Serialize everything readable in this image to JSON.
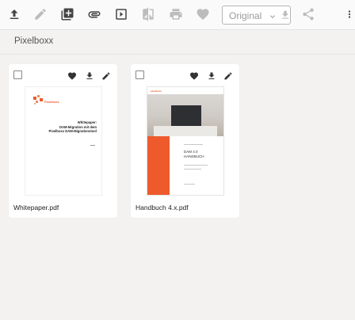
{
  "toolbar": {
    "icons": [
      {
        "name": "upload-icon",
        "state": "enabled"
      },
      {
        "name": "edit-icon",
        "state": "disabled"
      },
      {
        "name": "add-to-collection-icon",
        "state": "enabled"
      },
      {
        "name": "attachment-icon",
        "state": "enabled"
      },
      {
        "name": "slideshow-icon",
        "state": "enabled"
      },
      {
        "name": "compare-icon",
        "state": "disabled"
      },
      {
        "name": "print-icon",
        "state": "disabled"
      },
      {
        "name": "favorite-icon",
        "state": "disabled"
      },
      {
        "name": "share-icon",
        "state": "disabled"
      },
      {
        "name": "more-vertical-icon",
        "state": "enabled"
      }
    ],
    "format_select": {
      "value": "Original",
      "chevron_icon": "chevron-down-icon",
      "download_icon": "download-icon"
    }
  },
  "breadcrumb": {
    "label": "Pixelboxx"
  },
  "assets": [
    {
      "filename": "Whitepaper.pdf",
      "actions": [
        "favorite-icon",
        "download-icon",
        "edit-icon"
      ],
      "thumbnail": {
        "logo_text": "Pixelboxx",
        "title_lines": [
          "Whitepaper:",
          "DAM-Migration mit dem",
          "Pixelboxx DAM-Migrationstool"
        ]
      }
    },
    {
      "filename": "Handbuch 4.x.pdf",
      "actions": [
        "favorite-icon",
        "download-icon",
        "edit-icon"
      ],
      "thumbnail": {
        "logo_text": "pixelboxx",
        "title_lines": [
          "DAM 4.0",
          "HANDBUCH"
        ]
      }
    }
  ],
  "colors": {
    "background": "#f3f2f1",
    "toolbar": "#fafafa",
    "icon_enabled": "#444444",
    "icon_disabled": "#bcbcbc",
    "brand_orange": "#ee5a2c"
  }
}
